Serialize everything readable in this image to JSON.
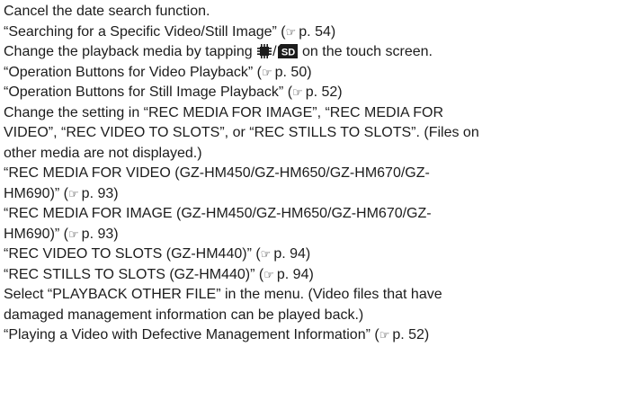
{
  "lines": {
    "l1": "Cancel the date search function.",
    "l2_text": "“Searching for a Specific Video/Still Image” (",
    "l2_page": "p. 54)",
    "l3_pre": "Change the playback media by tapping",
    "l3_sep": "/",
    "l3_sd": "SD",
    "l3_post": "on the touch screen.",
    "l4_text": "“Operation Buttons for Video Playback” (",
    "l4_page": "p. 50)",
    "l5_text": "“Operation Buttons for Still Image Playback” (",
    "l5_page": "p. 52)",
    "l6": "Change the setting in “REC MEDIA FOR IMAGE”, “REC MEDIA FOR",
    "l7": "VIDEO”, “REC VIDEO TO SLOTS”, or “REC STILLS TO SLOTS”. (Files on",
    "l8": "other media are not displayed.)",
    "l9": "“REC MEDIA FOR VIDEO (GZ-HM450/GZ-HM650/GZ-HM670/GZ-",
    "l10_text": "HM690)” (",
    "l10_page": "p. 93)",
    "l11": "“REC MEDIA FOR IMAGE (GZ-HM450/GZ-HM650/GZ-HM670/GZ-",
    "l12_text": "HM690)” (",
    "l12_page": "p. 93)",
    "l13_text": "“REC VIDEO TO SLOTS (GZ-HM440)” (",
    "l13_page": "p. 94)",
    "l14_text": "“REC STILLS TO SLOTS (GZ-HM440)” (",
    "l14_page": "p. 94)",
    "l15": "Select “PLAYBACK OTHER FILE” in the menu. (Video files that have",
    "l16": "damaged management information can be played back.)",
    "l17_text": "“Playing a Video with Defective Management Information” (",
    "l17_page": "p. 52)"
  },
  "icons": {
    "reference": "pointing-hand-icon",
    "built_in_memory": "chip-memory-icon",
    "sd_card": "sd-card-icon"
  }
}
